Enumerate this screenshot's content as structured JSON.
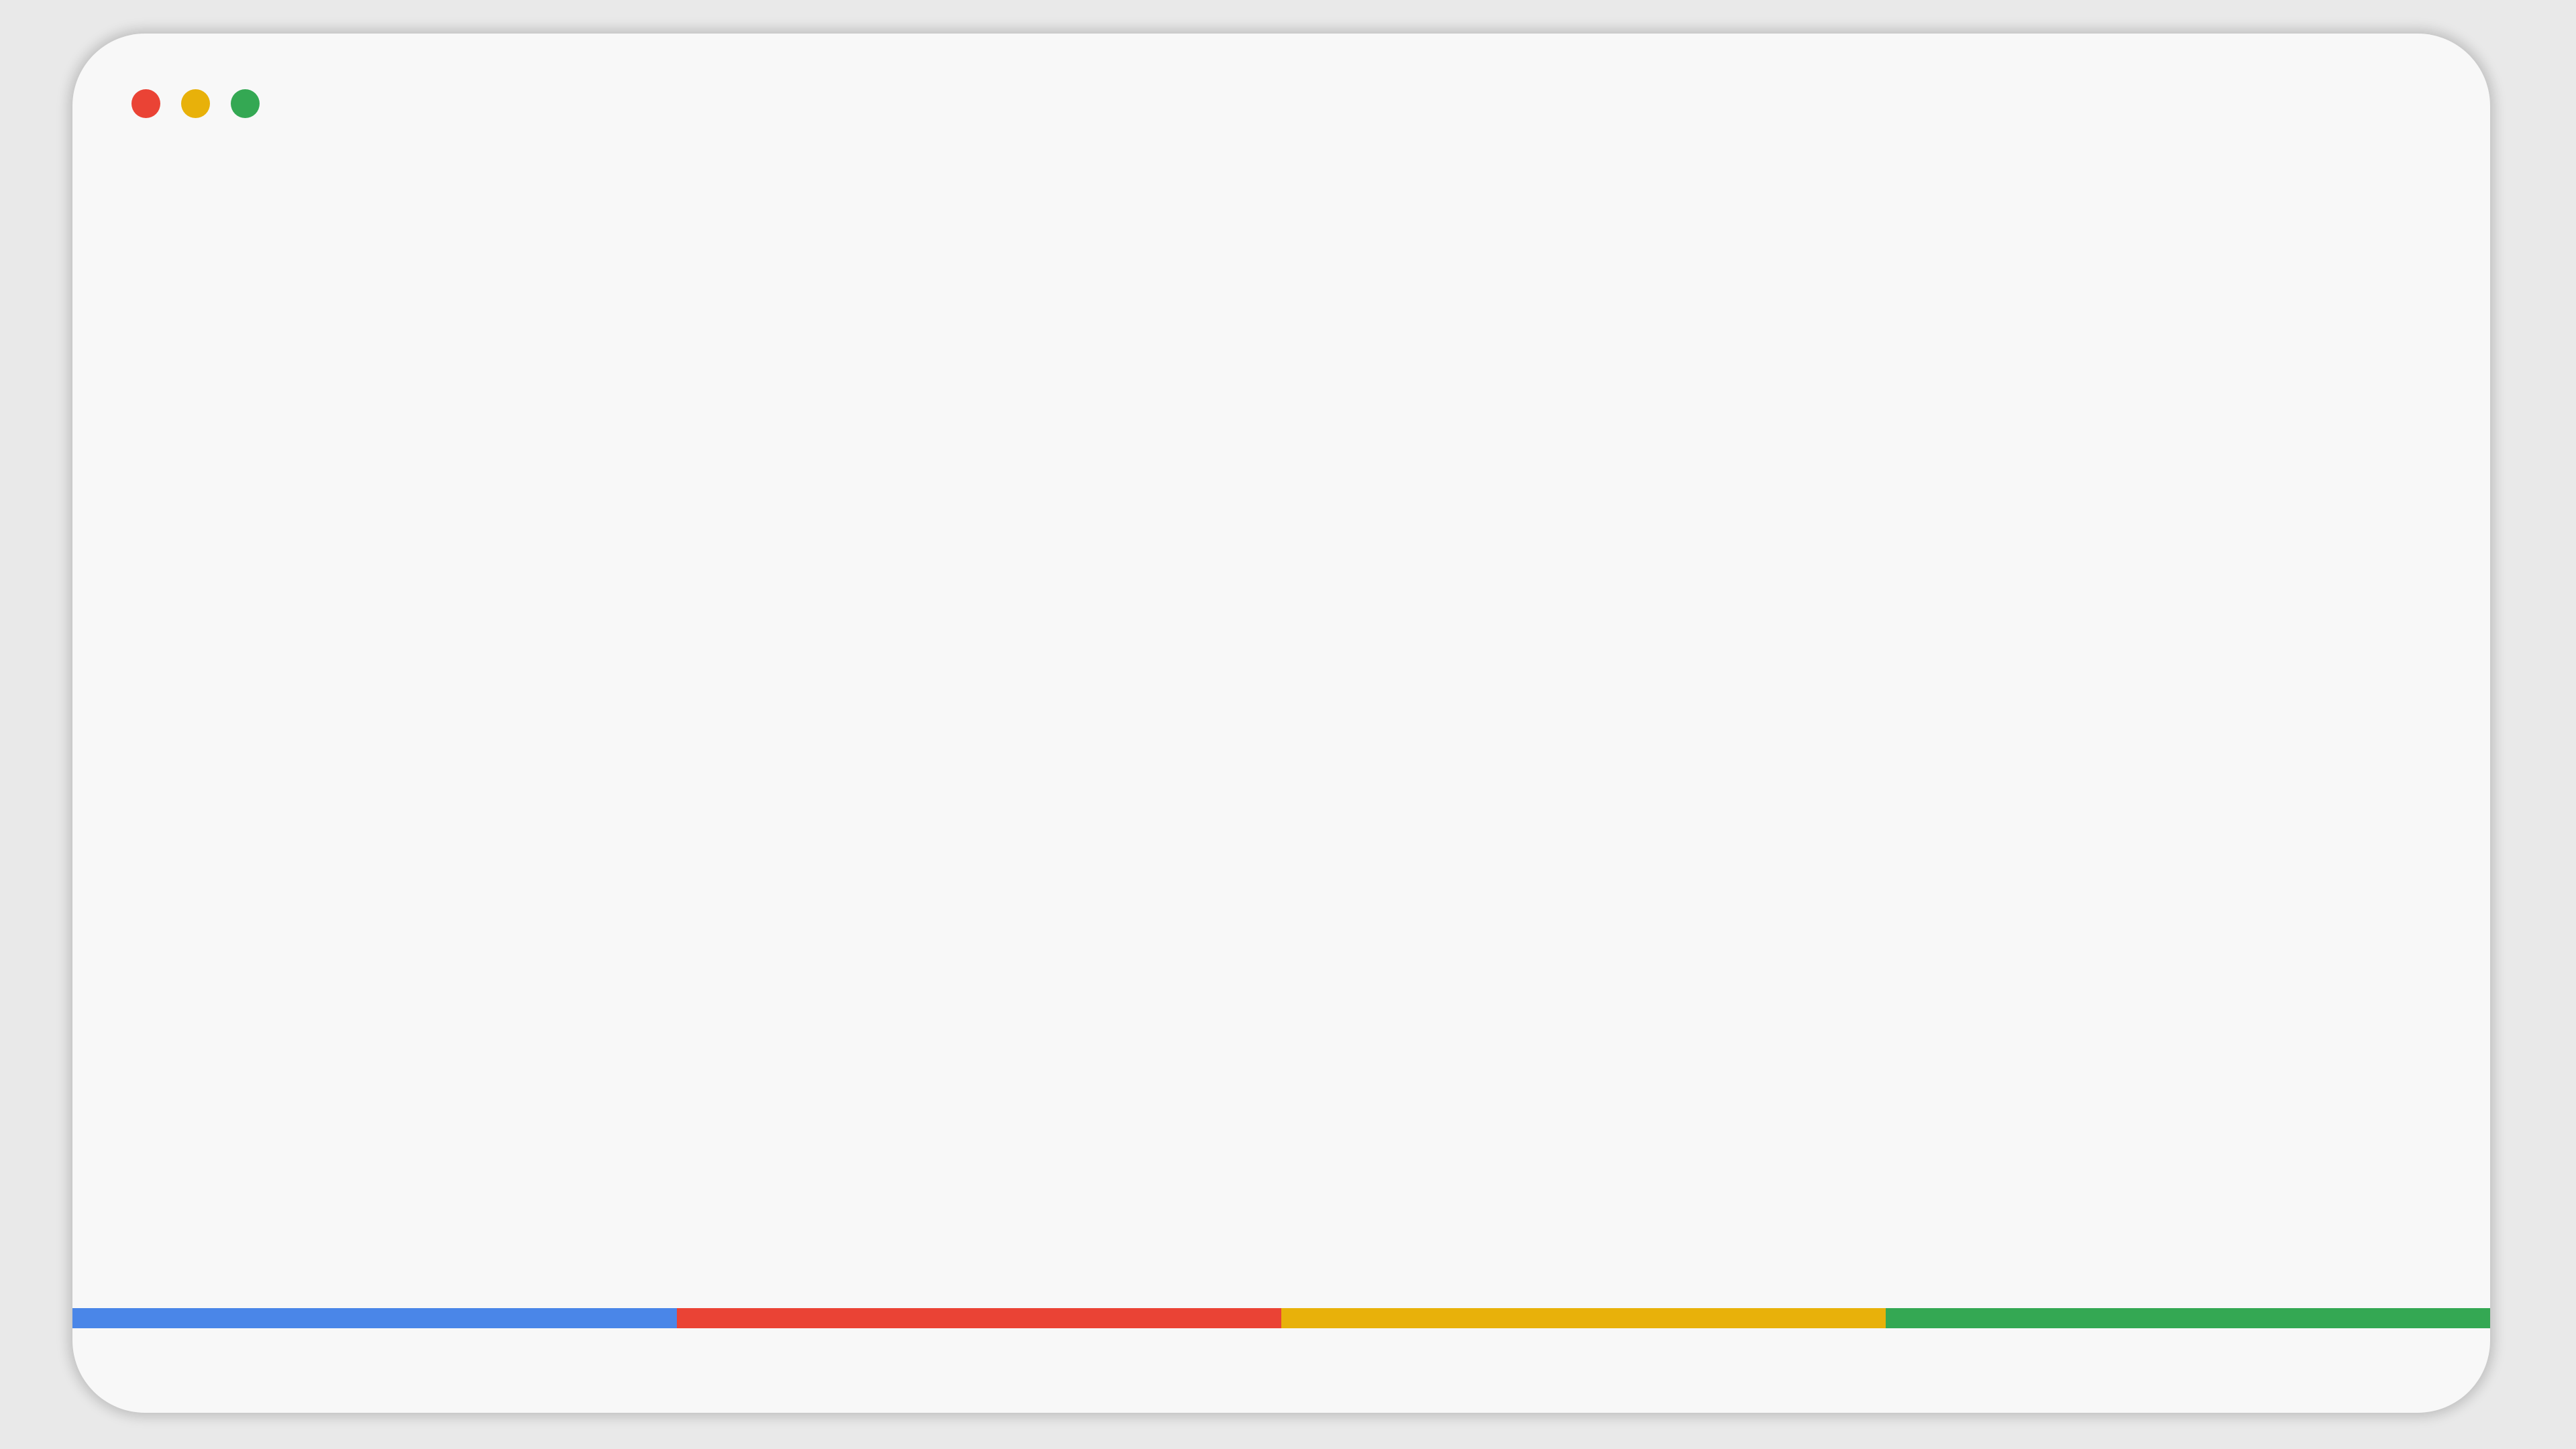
{
  "window": {
    "background": "#f8f8f8"
  },
  "traffic_lights": [
    {
      "name": "close",
      "color": "#ea4335"
    },
    {
      "name": "minimize",
      "color": "#e8b10a"
    },
    {
      "name": "maximize",
      "color": "#34a853"
    }
  ],
  "brand_bar": [
    {
      "name": "blue",
      "color": "#4a86e8"
    },
    {
      "name": "red",
      "color": "#ea4335"
    },
    {
      "name": "yellow",
      "color": "#e8b10a"
    },
    {
      "name": "green",
      "color": "#34a853"
    }
  ]
}
